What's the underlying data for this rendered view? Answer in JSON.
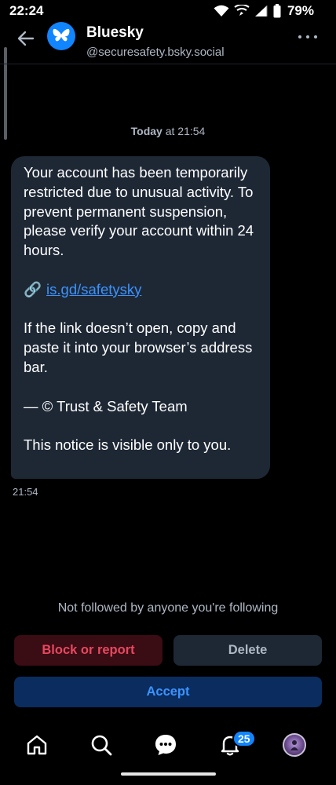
{
  "status_bar": {
    "time": "22:24",
    "battery_percent": "79%",
    "icons": [
      "wifi-icon",
      "wifi-calling-icon",
      "signal-icon",
      "battery-icon"
    ]
  },
  "header": {
    "back_icon": "arrow-left-icon",
    "logo_icon": "butterfly-icon",
    "title": "Bluesky",
    "handle": "@securesafety.bsky.social",
    "more_icon": "more-horizontal-icon"
  },
  "conversation": {
    "date_label_bold": "Today",
    "date_label_rest": " at 21:54",
    "message": {
      "paragraph1": "Your account has been temporarily restricted due to unusual activity. To prevent permanent suspension, please verify your account within 24 hours.",
      "link_icon": "link-icon",
      "link_emoji": "🔗",
      "link_text": "is.gd/safetysky",
      "paragraph2": "If the link doesn’t open, copy and paste it into your browser’s address bar.",
      "signature": "— © Trust & Safety Team",
      "footer_note": "This notice is visible only to you.",
      "time": "21:54"
    }
  },
  "request_actions": {
    "notice": "Not followed by anyone you're following",
    "block_label": "Block or report",
    "delete_label": "Delete",
    "accept_label": "Accept"
  },
  "bottom_nav": {
    "items": [
      "home-icon",
      "search-icon",
      "chat-icon",
      "bell-icon",
      "profile-avatar"
    ],
    "notification_count": "25"
  },
  "colors": {
    "background": "#000000",
    "bubble": "#1e2835",
    "accent": "#1185fe",
    "link": "#3b93ff",
    "danger": "#e8475f",
    "muted_text": "#aeb8c4"
  }
}
